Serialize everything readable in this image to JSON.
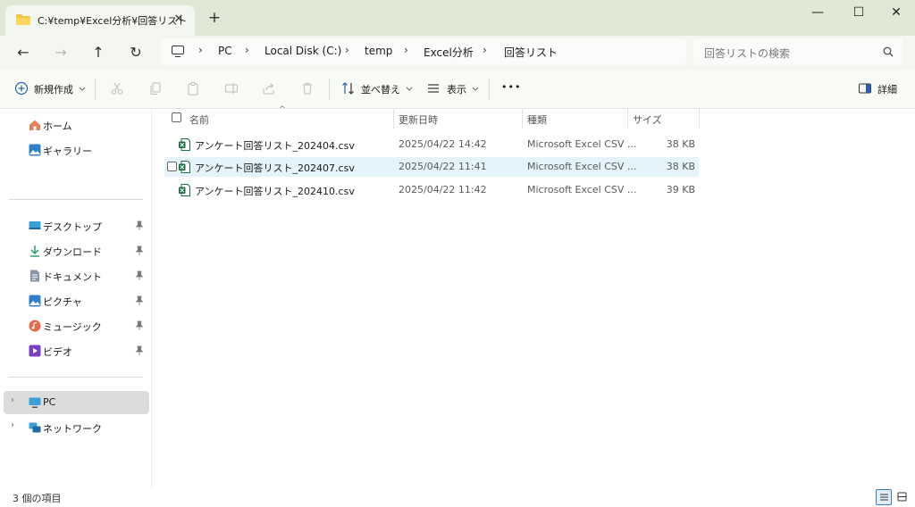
{
  "window": {
    "tab_title": "C:¥temp¥Excel分析¥回答リスト",
    "tab_close": "✕",
    "new_tab": "+",
    "minimize": "—",
    "maximize": "☐",
    "close": "✕"
  },
  "nav": {
    "back": "←",
    "forward": "→",
    "up": "↑",
    "refresh": "↻"
  },
  "breadcrumb": [
    "PC",
    "Local Disk (C:)",
    "temp",
    "Excel分析",
    "回答リスト"
  ],
  "breadcrumb_sep": "›",
  "search": {
    "placeholder": "回答リストの検索"
  },
  "toolbar": {
    "new_label": "新規作成",
    "sort_label": "並べ替え",
    "view_label": "表示",
    "more_label": "•••",
    "details_label": "詳細"
  },
  "sidebar": {
    "top": [
      {
        "label": "ホーム",
        "icon": "home-icon"
      },
      {
        "label": "ギャラリー",
        "icon": "gallery-icon"
      }
    ],
    "quick": [
      {
        "label": "デスクトップ",
        "icon": "desktop-icon"
      },
      {
        "label": "ダウンロード",
        "icon": "download-icon"
      },
      {
        "label": "ドキュメント",
        "icon": "document-icon"
      },
      {
        "label": "ピクチャ",
        "icon": "pictures-icon"
      },
      {
        "label": "ミュージック",
        "icon": "music-icon"
      },
      {
        "label": "ビデオ",
        "icon": "video-icon"
      }
    ],
    "locations": [
      {
        "label": "PC",
        "icon": "pc-icon",
        "selected": true
      },
      {
        "label": "ネットワーク",
        "icon": "network-icon",
        "selected": false
      }
    ],
    "expand_glyph": "›"
  },
  "columns": {
    "name": "名前",
    "date": "更新日時",
    "type": "種類",
    "size": "サイズ",
    "sort_caret": "^"
  },
  "files": [
    {
      "name": "アンケート回答リスト_202404.csv",
      "date": "2025/04/22 14:42",
      "type": "Microsoft Excel CSV ...",
      "size": "38 KB",
      "hover": false
    },
    {
      "name": "アンケート回答リスト_202407.csv",
      "date": "2025/04/22 11:41",
      "type": "Microsoft Excel CSV ...",
      "size": "38 KB",
      "hover": true
    },
    {
      "name": "アンケート回答リスト_202410.csv",
      "date": "2025/04/22 11:42",
      "type": "Microsoft Excel CSV ...",
      "size": "39 KB",
      "hover": false
    }
  ],
  "status": {
    "item_count": "3 個の項目"
  },
  "colors": {
    "title_bg": "#dfe9d5",
    "accent": "#3b78c6",
    "excel_green": "#1d7044",
    "hover_row": "#e5f3fb"
  }
}
